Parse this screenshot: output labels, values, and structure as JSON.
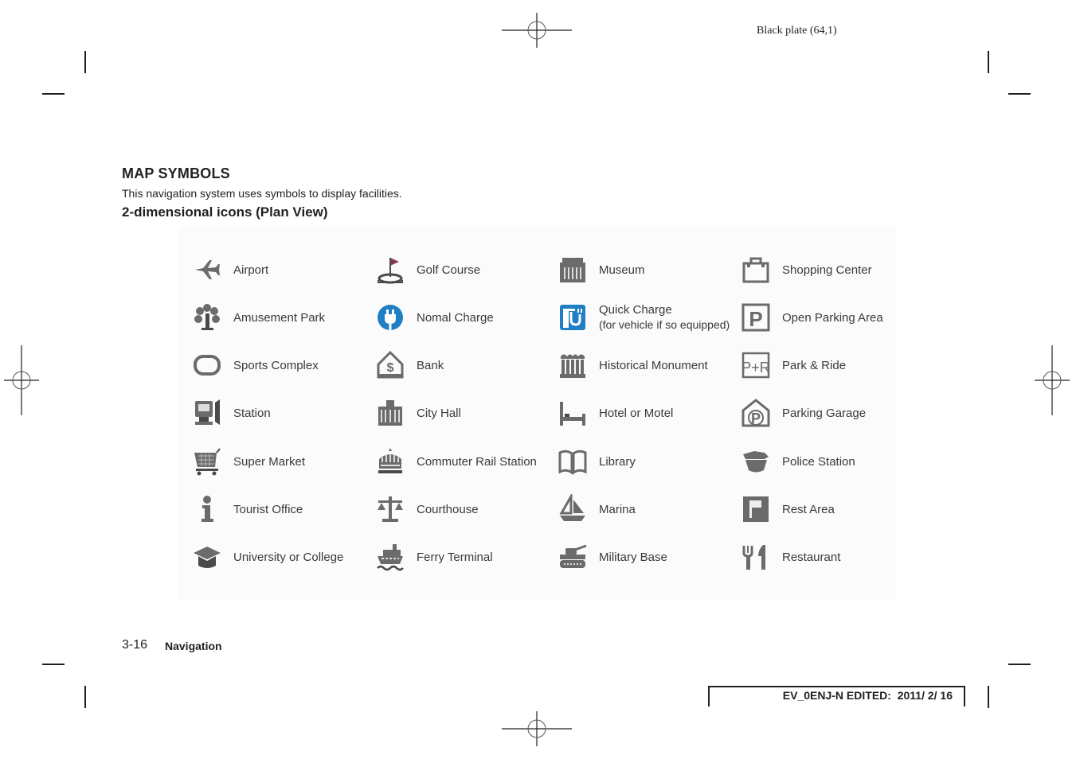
{
  "header": {
    "plate_label": "Black plate (64,1)"
  },
  "section": {
    "title": "MAP SYMBOLS",
    "description": "This navigation system uses symbols to display facilities.",
    "subtitle": "2-dimensional icons (Plan View)"
  },
  "colors": {
    "icon_gray": "#6b6b6b",
    "charge_blue": "#1f7fc4",
    "golf_flag": "#8a3a4e",
    "text": "#231f20"
  },
  "symbols": [
    [
      {
        "icon": "airplane-icon",
        "label": "Airport"
      },
      {
        "icon": "tree-icon",
        "label": "Amusement Park"
      },
      {
        "icon": "stadium-icon",
        "label": "Sports Complex"
      },
      {
        "icon": "train-station-icon",
        "label": "Station"
      },
      {
        "icon": "shopping-cart-icon",
        "label": "Super Market"
      },
      {
        "icon": "info-icon",
        "label": "Tourist Office"
      },
      {
        "icon": "graduation-cap-icon",
        "label": "University or College"
      }
    ],
    [
      {
        "icon": "golf-flag-icon",
        "label": "Golf Course"
      },
      {
        "icon": "plug-icon",
        "label": "Nomal Charge"
      },
      {
        "icon": "bank-icon",
        "label": "Bank"
      },
      {
        "icon": "city-hall-icon",
        "label": "City Hall"
      },
      {
        "icon": "commuter-train-icon",
        "label": "Commuter Rail Station"
      },
      {
        "icon": "scales-icon",
        "label": "Courthouse"
      },
      {
        "icon": "ferry-icon",
        "label": "Ferry Terminal"
      }
    ],
    [
      {
        "icon": "museum-icon",
        "label": "Museum"
      },
      {
        "icon": "quick-charge-icon",
        "label": "Quick Charge",
        "sublabel": "(for vehicle if so equipped)"
      },
      {
        "icon": "monument-icon",
        "label": "Historical Monument"
      },
      {
        "icon": "bed-icon",
        "label": "Hotel or Motel"
      },
      {
        "icon": "book-icon",
        "label": "Library"
      },
      {
        "icon": "sailboat-icon",
        "label": "Marina"
      },
      {
        "icon": "tank-icon",
        "label": "Military Base"
      }
    ],
    [
      {
        "icon": "shopping-bag-icon",
        "label": "Shopping Center"
      },
      {
        "icon": "parking-icon",
        "label": "Open Parking Area"
      },
      {
        "icon": "park-and-ride-icon",
        "label": "Park & Ride"
      },
      {
        "icon": "parking-garage-icon",
        "label": "Parking Garage"
      },
      {
        "icon": "police-icon",
        "label": "Police Station"
      },
      {
        "icon": "rest-area-icon",
        "label": "Rest Area"
      },
      {
        "icon": "fork-knife-icon",
        "label": "Restaurant"
      }
    ]
  ],
  "footer": {
    "page_number": "3-16",
    "section_name": "Navigation",
    "edited_stamp": "EV_0ENJ-N EDITED:  2011/ 2/ 16"
  }
}
